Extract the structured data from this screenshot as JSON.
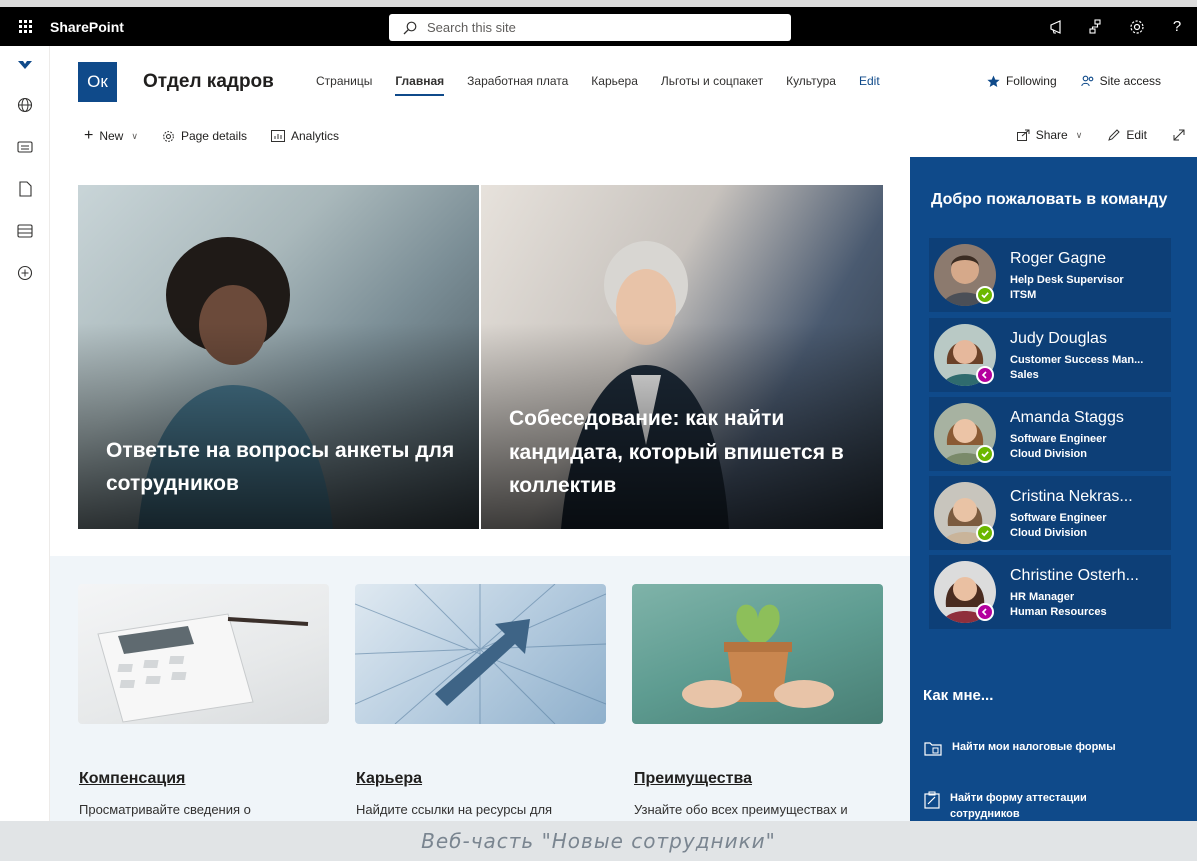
{
  "suite": {
    "brand": "SharePoint",
    "search_placeholder": "Search this site"
  },
  "site": {
    "logo_text": "Ок",
    "title": "Отдел кадров",
    "nav": [
      "Страницы",
      "Главная",
      "Заработная плата",
      "Карьера",
      "Льготы и соцпакет",
      "Культура",
      "Edit"
    ],
    "active_nav": "Главная",
    "following": "Following",
    "site_access": "Site access"
  },
  "command_bar": {
    "new": "New",
    "page_details": "Page details",
    "analytics": "Analytics",
    "share": "Share",
    "edit": "Edit"
  },
  "hero": {
    "left_caption": "Ответьте на вопросы анкеты для сотрудников",
    "right_caption": "Собеседование: как найти кандидата, который впишется в коллектив"
  },
  "cards": [
    {
      "title": "Компенсация",
      "desc": "Просматривайте сведения о"
    },
    {
      "title": "Карьера",
      "desc": "Найдите ссылки на ресурсы для"
    },
    {
      "title": "Преимущества",
      "desc": "Узнайте обо всех преимуществах и"
    }
  ],
  "panel": {
    "title": "Добро пожаловать в команду",
    "people": [
      {
        "name": "Roger Gagne",
        "role": "Help Desk Supervisor",
        "dept": "ITSM",
        "presence": "available"
      },
      {
        "name": "Judy Douglas",
        "role": "Customer Success Man...",
        "dept": "Sales",
        "presence": "away"
      },
      {
        "name": "Amanda Staggs",
        "role": "Software Engineer",
        "dept": "Cloud Division",
        "presence": "available"
      },
      {
        "name": "Cristina Nekras...",
        "role": "Software Engineer",
        "dept": "Cloud Division",
        "presence": "available"
      },
      {
        "name": "Christine Osterh...",
        "role": "HR Manager",
        "dept": "Human Resources",
        "presence": "away"
      }
    ],
    "howto_title": "Как мне...",
    "howto_items": [
      "Найти мои налоговые формы",
      "Найти форму аттестации сотрудников"
    ]
  },
  "caption": "Веб-часть \"Новые сотрудники\"",
  "colors": {
    "brand": "#0f4a8a",
    "band": "#f0f5f9",
    "presence_available": "#6bb700",
    "presence_away": "#b4009e"
  }
}
